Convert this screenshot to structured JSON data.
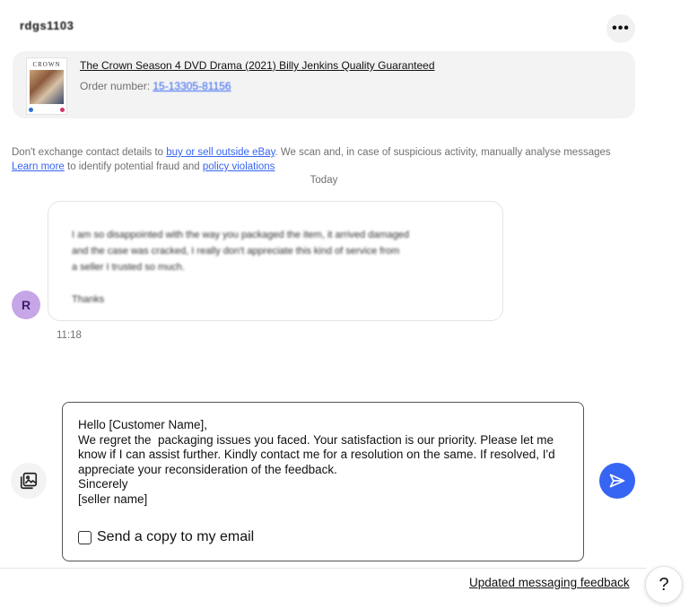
{
  "header": {
    "username": "rdgs1103",
    "more_icon": "ellipsis-icon",
    "more_label": "•••"
  },
  "item": {
    "thumb_title": "CROWN",
    "title": "The Crown Season 4 DVD Drama (2021) Billy Jenkins Quality Guaranteed",
    "order_label": "Order number:",
    "order_number": "15-13305-81156"
  },
  "notice": {
    "part1": "Don't exchange contact details to ",
    "link1": "buy or sell outside eBay",
    "part2": ". We scan and, in case of suspicious activity, manually analyse messages ",
    "link2": "Learn more",
    "part3": " to identify potential fraud and ",
    "link3": "policy violations"
  },
  "day_label": "Today",
  "message": {
    "avatar_letter": "R",
    "line1": "I am so disappointed with the way you packaged the item, it arrived damaged",
    "line2": "and the case was cracked, I really don't appreciate this kind of service from",
    "line3": "a seller I trusted so much.",
    "line4": "Thanks",
    "time": "11:18"
  },
  "compose": {
    "text": "Hello [Customer Name],\nWe regret the  packaging issues you faced. Your satisfaction is our priority. Please let me know if I can assist further. Kindly contact me for a resolution on the same. If resolved, I'd appreciate your reconsideration of the feedback.\nSincerely\n[seller name]",
    "copy_label": "Send a copy to my email"
  },
  "footer": {
    "feedback_link": "Updated messaging feedback",
    "help_label": "?"
  },
  "colors": {
    "accent": "#3665f3",
    "avatar_bg": "#c6a6e6",
    "card_bg": "#f3f3f3"
  }
}
